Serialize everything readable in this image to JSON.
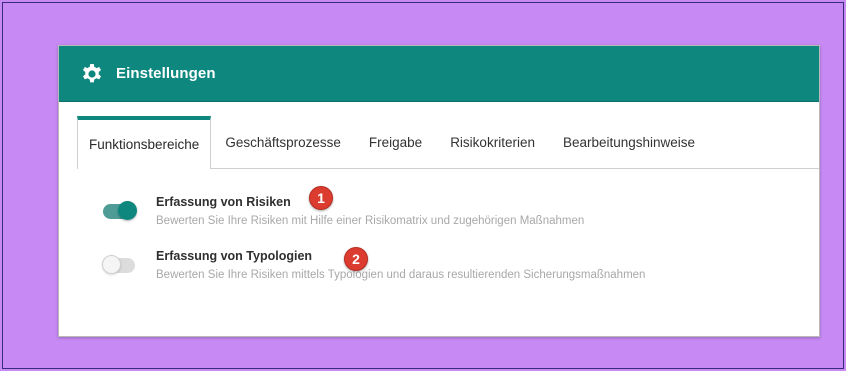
{
  "header": {
    "title": "Einstellungen",
    "icon": "gear-icon",
    "color": "#0e877f"
  },
  "tabs": [
    {
      "label": "Funktionsbereiche",
      "active": true
    },
    {
      "label": "Geschäftsprozesse",
      "active": false
    },
    {
      "label": "Freigabe",
      "active": false
    },
    {
      "label": "Risikokriterien",
      "active": false
    },
    {
      "label": "Bearbeitungshinweise",
      "active": false
    }
  ],
  "settings": [
    {
      "label": "Erfassung von Risiken",
      "description": "Bewerten Sie Ihre Risiken mit Hilfe einer Risikomatrix und zugehörigen Maßnahmen",
      "enabled": true,
      "badge": "1"
    },
    {
      "label": "Erfassung von Typologien",
      "description": "Bewerten Sie Ihre Risiken mittels Typologien und daraus resultierenden Sicherungsmaßnahmen",
      "enabled": false,
      "badge": "2"
    }
  ],
  "colors": {
    "background": "#c78af5",
    "accent": "#0e877f",
    "badge": "#dc3b2f"
  }
}
